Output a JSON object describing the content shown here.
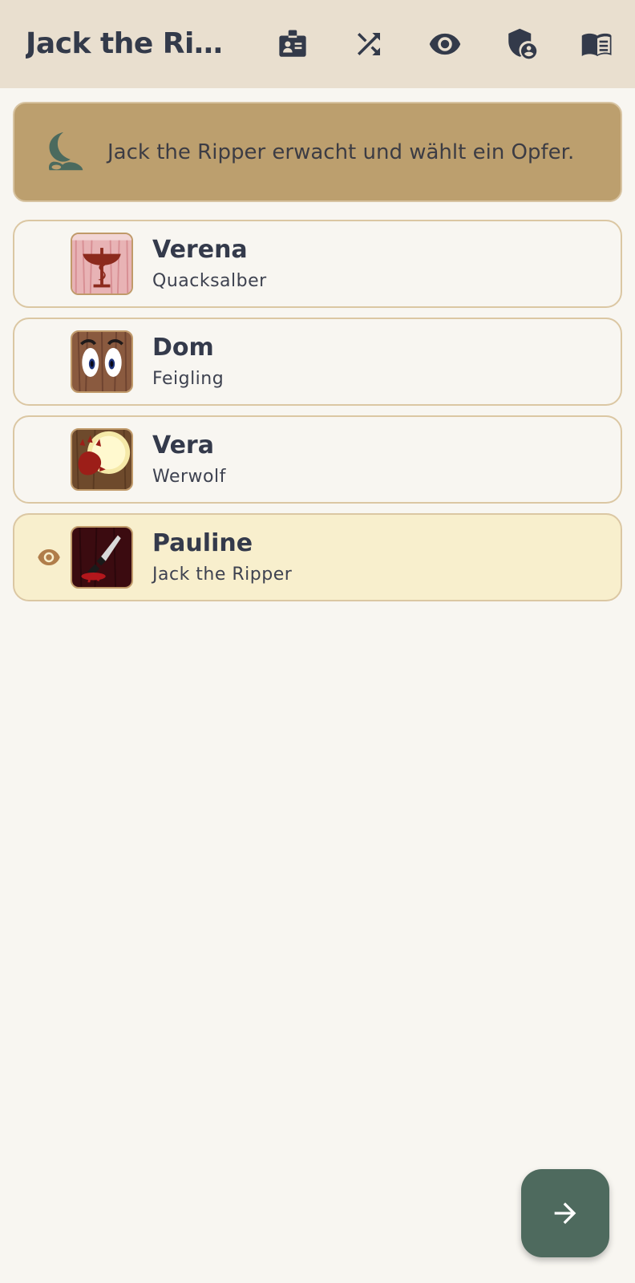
{
  "app_bar": {
    "title": "Jack the Ripper",
    "actions": [
      "id-badge-icon",
      "shuffle-icon",
      "eye-icon",
      "shield-user-icon",
      "book-icon"
    ]
  },
  "banner": {
    "icon": "moon-icon",
    "text": "Jack the Ripper erwacht und wählt ein Opfer."
  },
  "players": [
    {
      "name": "Verena",
      "role": "Quacksalber",
      "avatar": "caduceus-card",
      "selected": false
    },
    {
      "name": "Dom",
      "role": "Feigling",
      "avatar": "scared-eyes-card",
      "selected": false
    },
    {
      "name": "Vera",
      "role": "Werwolf",
      "avatar": "werewolf-moon-card",
      "selected": false
    },
    {
      "name": "Pauline",
      "role": "Jack the Ripper",
      "avatar": "knife-card",
      "selected": true
    }
  ],
  "fab": {
    "icon": "arrow-right-icon"
  },
  "colors": {
    "app_bar_bg": "#e9dfcf",
    "banner_bg": "#bc9f6e",
    "selected_bg": "#f8efcd",
    "fab_bg": "#4e6a5e",
    "accent": "#b07d4a"
  }
}
